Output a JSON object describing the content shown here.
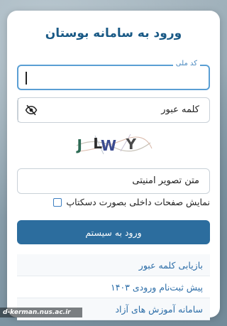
{
  "page": {
    "title": "ورود به سامانه بوستان"
  },
  "form": {
    "national_code_label": "کد ملی",
    "national_code_value": "",
    "password_placeholder": "کلمه عبور",
    "captcha_text": "JLWY",
    "captcha_placeholder": "متن تصویر امنیتی",
    "desktop_mode_label": "نمایش صفحات داخلی بصورت دسکتاپ",
    "desktop_mode_checked": false,
    "submit_label": "ورود به سیستم"
  },
  "links": [
    {
      "label": "بازیابی کلمه عبور"
    },
    {
      "label": "پیش ثبت‌نام ورودی ۱۴۰۳"
    },
    {
      "label": "سامانه آموزش های آزاد"
    }
  ],
  "watermark": {
    "text": "d-kerman.nus.ac.ir"
  },
  "colors": {
    "primary": "#2c6d9e",
    "title": "#1a5a86",
    "focus_border": "#5a9fd4",
    "link": "#2d6ea8"
  }
}
